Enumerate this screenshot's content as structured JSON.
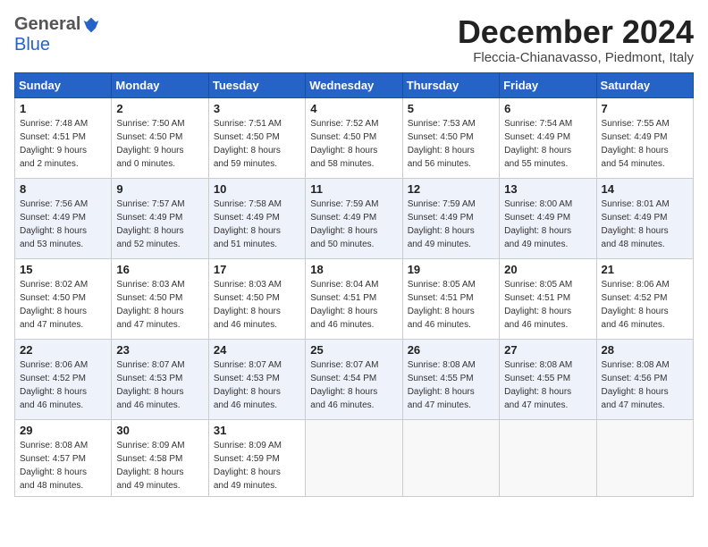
{
  "header": {
    "logo_general": "General",
    "logo_blue": "Blue",
    "month": "December 2024",
    "location": "Fleccia-Chianavasso, Piedmont, Italy"
  },
  "weekdays": [
    "Sunday",
    "Monday",
    "Tuesday",
    "Wednesday",
    "Thursday",
    "Friday",
    "Saturday"
  ],
  "weeks": [
    [
      {
        "day": "1",
        "info": "Sunrise: 7:48 AM\nSunset: 4:51 PM\nDaylight: 9 hours\nand 2 minutes."
      },
      {
        "day": "2",
        "info": "Sunrise: 7:50 AM\nSunset: 4:50 PM\nDaylight: 9 hours\nand 0 minutes."
      },
      {
        "day": "3",
        "info": "Sunrise: 7:51 AM\nSunset: 4:50 PM\nDaylight: 8 hours\nand 59 minutes."
      },
      {
        "day": "4",
        "info": "Sunrise: 7:52 AM\nSunset: 4:50 PM\nDaylight: 8 hours\nand 58 minutes."
      },
      {
        "day": "5",
        "info": "Sunrise: 7:53 AM\nSunset: 4:50 PM\nDaylight: 8 hours\nand 56 minutes."
      },
      {
        "day": "6",
        "info": "Sunrise: 7:54 AM\nSunset: 4:49 PM\nDaylight: 8 hours\nand 55 minutes."
      },
      {
        "day": "7",
        "info": "Sunrise: 7:55 AM\nSunset: 4:49 PM\nDaylight: 8 hours\nand 54 minutes."
      }
    ],
    [
      {
        "day": "8",
        "info": "Sunrise: 7:56 AM\nSunset: 4:49 PM\nDaylight: 8 hours\nand 53 minutes."
      },
      {
        "day": "9",
        "info": "Sunrise: 7:57 AM\nSunset: 4:49 PM\nDaylight: 8 hours\nand 52 minutes."
      },
      {
        "day": "10",
        "info": "Sunrise: 7:58 AM\nSunset: 4:49 PM\nDaylight: 8 hours\nand 51 minutes."
      },
      {
        "day": "11",
        "info": "Sunrise: 7:59 AM\nSunset: 4:49 PM\nDaylight: 8 hours\nand 50 minutes."
      },
      {
        "day": "12",
        "info": "Sunrise: 7:59 AM\nSunset: 4:49 PM\nDaylight: 8 hours\nand 49 minutes."
      },
      {
        "day": "13",
        "info": "Sunrise: 8:00 AM\nSunset: 4:49 PM\nDaylight: 8 hours\nand 49 minutes."
      },
      {
        "day": "14",
        "info": "Sunrise: 8:01 AM\nSunset: 4:49 PM\nDaylight: 8 hours\nand 48 minutes."
      }
    ],
    [
      {
        "day": "15",
        "info": "Sunrise: 8:02 AM\nSunset: 4:50 PM\nDaylight: 8 hours\nand 47 minutes."
      },
      {
        "day": "16",
        "info": "Sunrise: 8:03 AM\nSunset: 4:50 PM\nDaylight: 8 hours\nand 47 minutes."
      },
      {
        "day": "17",
        "info": "Sunrise: 8:03 AM\nSunset: 4:50 PM\nDaylight: 8 hours\nand 46 minutes."
      },
      {
        "day": "18",
        "info": "Sunrise: 8:04 AM\nSunset: 4:51 PM\nDaylight: 8 hours\nand 46 minutes."
      },
      {
        "day": "19",
        "info": "Sunrise: 8:05 AM\nSunset: 4:51 PM\nDaylight: 8 hours\nand 46 minutes."
      },
      {
        "day": "20",
        "info": "Sunrise: 8:05 AM\nSunset: 4:51 PM\nDaylight: 8 hours\nand 46 minutes."
      },
      {
        "day": "21",
        "info": "Sunrise: 8:06 AM\nSunset: 4:52 PM\nDaylight: 8 hours\nand 46 minutes."
      }
    ],
    [
      {
        "day": "22",
        "info": "Sunrise: 8:06 AM\nSunset: 4:52 PM\nDaylight: 8 hours\nand 46 minutes."
      },
      {
        "day": "23",
        "info": "Sunrise: 8:07 AM\nSunset: 4:53 PM\nDaylight: 8 hours\nand 46 minutes."
      },
      {
        "day": "24",
        "info": "Sunrise: 8:07 AM\nSunset: 4:53 PM\nDaylight: 8 hours\nand 46 minutes."
      },
      {
        "day": "25",
        "info": "Sunrise: 8:07 AM\nSunset: 4:54 PM\nDaylight: 8 hours\nand 46 minutes."
      },
      {
        "day": "26",
        "info": "Sunrise: 8:08 AM\nSunset: 4:55 PM\nDaylight: 8 hours\nand 47 minutes."
      },
      {
        "day": "27",
        "info": "Sunrise: 8:08 AM\nSunset: 4:55 PM\nDaylight: 8 hours\nand 47 minutes."
      },
      {
        "day": "28",
        "info": "Sunrise: 8:08 AM\nSunset: 4:56 PM\nDaylight: 8 hours\nand 47 minutes."
      }
    ],
    [
      {
        "day": "29",
        "info": "Sunrise: 8:08 AM\nSunset: 4:57 PM\nDaylight: 8 hours\nand 48 minutes."
      },
      {
        "day": "30",
        "info": "Sunrise: 8:09 AM\nSunset: 4:58 PM\nDaylight: 8 hours\nand 49 minutes."
      },
      {
        "day": "31",
        "info": "Sunrise: 8:09 AM\nSunset: 4:59 PM\nDaylight: 8 hours\nand 49 minutes."
      },
      {
        "day": "",
        "info": ""
      },
      {
        "day": "",
        "info": ""
      },
      {
        "day": "",
        "info": ""
      },
      {
        "day": "",
        "info": ""
      }
    ]
  ]
}
